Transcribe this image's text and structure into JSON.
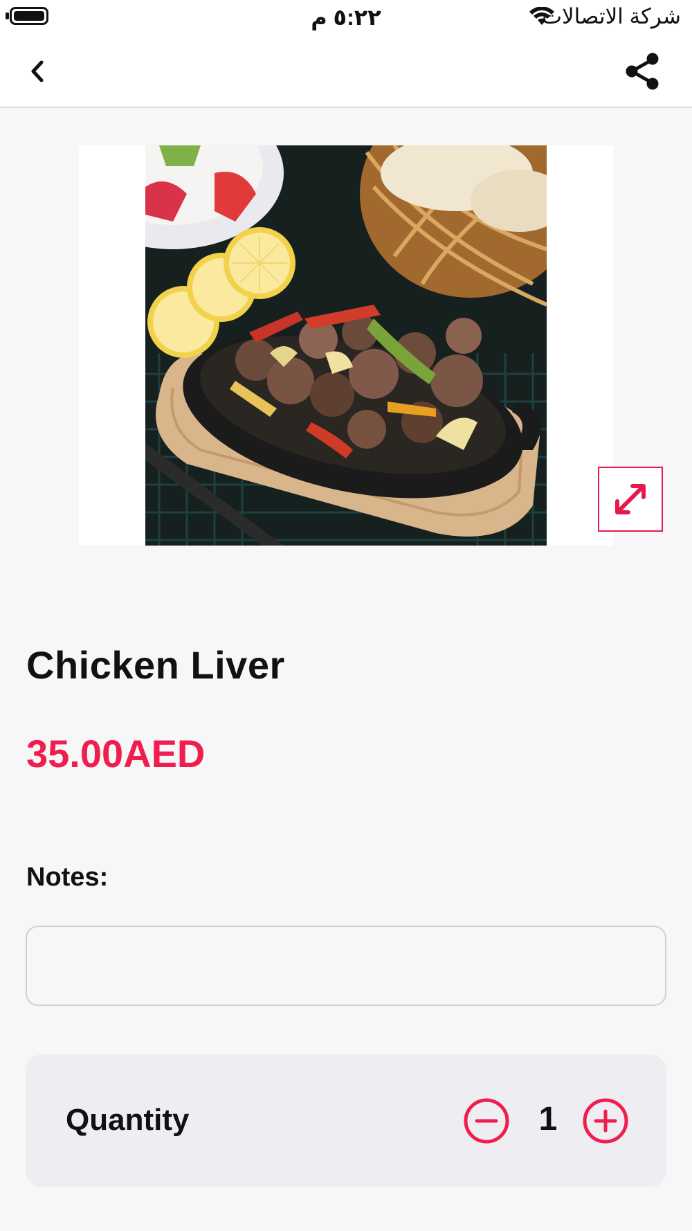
{
  "status_bar": {
    "time": "٥:٢٢ م",
    "carrier": "شركة الاتصالات",
    "icons": [
      "battery-icon",
      "wifi-icon"
    ]
  },
  "nav": {
    "back_icon": "chevron-left-icon",
    "share_icon": "share-icon"
  },
  "product": {
    "image_alt": "Chicken liver",
    "expand_icon": "expand-arrows-icon",
    "name": "Chicken Liver",
    "price": "35.00AED"
  },
  "notes": {
    "label": "Notes:",
    "value": "",
    "placeholder": ""
  },
  "quantity": {
    "label": "Quantity",
    "value": "1",
    "minus_icon": "minus-circle-icon",
    "plus_icon": "plus-circle-icon"
  },
  "colors": {
    "accent": "#f01d4e",
    "background": "#f7f7f8",
    "card": "#eeeef2"
  }
}
